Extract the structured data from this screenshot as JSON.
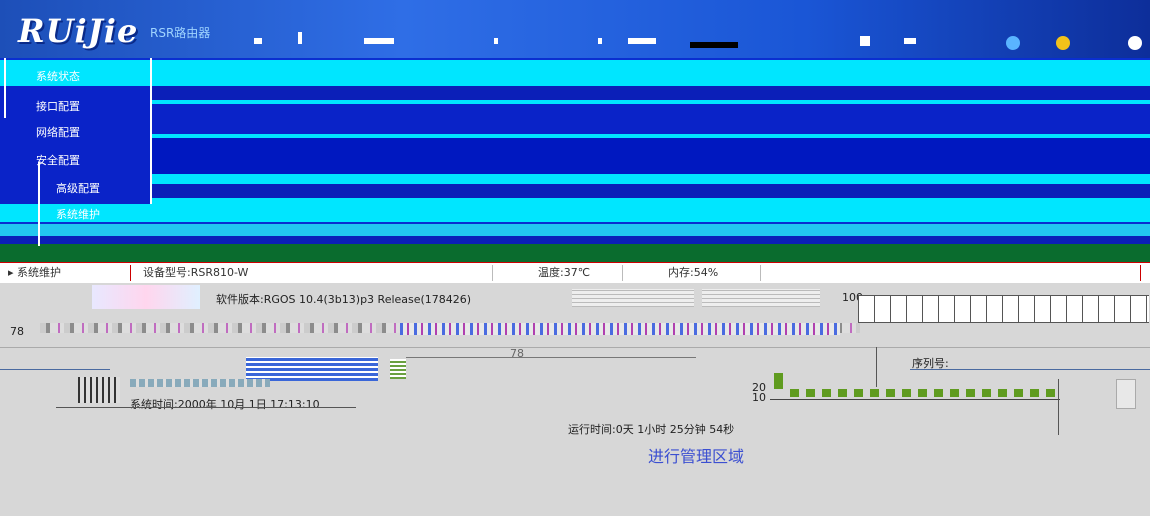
{
  "header": {
    "logo": "RUiJie",
    "product": "RSR路由器"
  },
  "nav": {
    "items": [
      {
        "label": "系统状态"
      },
      {
        "label": "接口配置"
      },
      {
        "label": "网络配置"
      },
      {
        "label": "安全配置"
      },
      {
        "label": "高级配置"
      },
      {
        "label": "系统维护"
      }
    ]
  },
  "sidebar": {
    "active_label": "▸ 系统维护"
  },
  "status_bar": {
    "device_model": "设备型号:RSR810-W",
    "temperature": "温度:37℃",
    "memory": "内存:54%"
  },
  "info": {
    "software_version": "软件版本:RGOS 10.4(3b13)p3 Release(178426)",
    "serial_label": "序列号:",
    "serial_partial": "序列号:",
    "system_time": "系统时间:2000年 10月 1日 17:13:10",
    "uptime": "运行时间:0天 1小时 25分钟 54秒",
    "service_link": "进行管理区域"
  },
  "chart": {
    "axis_top": "100",
    "axis_mid": "20",
    "axis_low": "10",
    "left_axis": "78"
  },
  "colors": {
    "header_blue": "#1a56d6",
    "nav_blue": "#0a2fd0",
    "accent_cyan": "#00e6ff",
    "bar_green": "#5f9b1f"
  }
}
